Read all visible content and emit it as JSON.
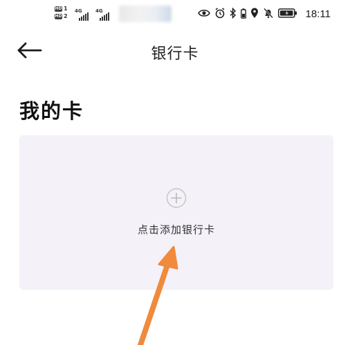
{
  "status_bar": {
    "sim1_badge": "HD",
    "sim1_num": "1",
    "sim2_badge": "HD",
    "sim2_num": "2",
    "network1": "4G",
    "network2": "4G",
    "time": "18:11",
    "icons": [
      "eye-icon",
      "alarm-icon",
      "bluetooth-icon",
      "location-icon",
      "mute-bell-icon",
      "battery-icon"
    ]
  },
  "nav": {
    "back_icon": "arrow-left-icon",
    "title": "银行卡"
  },
  "section": {
    "title": "我的卡"
  },
  "add_card": {
    "icon": "plus-circle-icon",
    "label": "点击添加银行卡"
  },
  "colors": {
    "panel_bg": "#f4f1f8",
    "annotation_arrow": "#f08a3c"
  }
}
